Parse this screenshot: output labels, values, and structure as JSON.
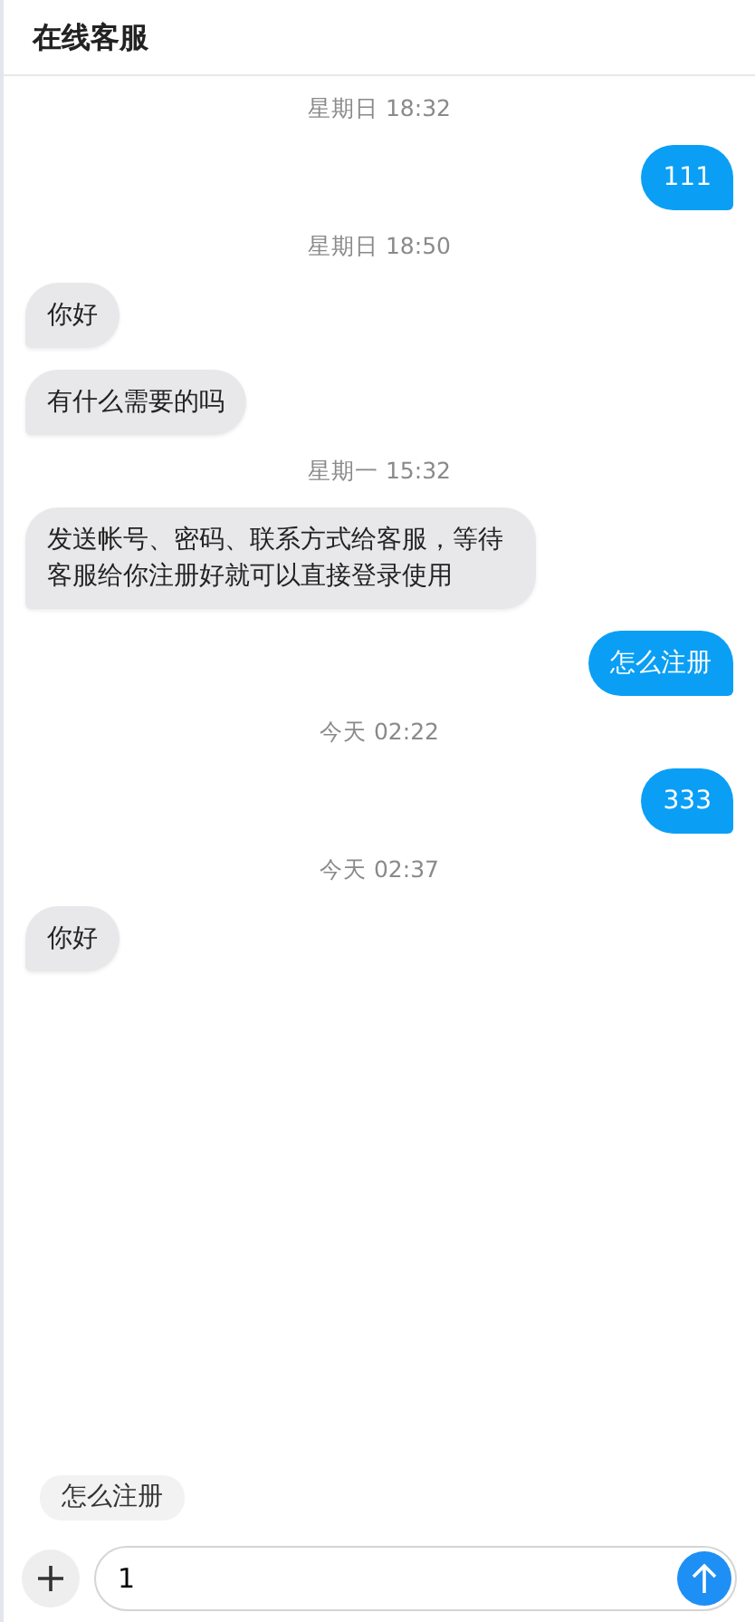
{
  "header": {
    "title": "在线客服"
  },
  "messages": [
    {
      "kind": "time",
      "text": "星期日 18:32"
    },
    {
      "kind": "out",
      "text": "111"
    },
    {
      "kind": "time",
      "text": "星期日 18:50"
    },
    {
      "kind": "in",
      "text": "你好"
    },
    {
      "kind": "in",
      "text": "有什么需要的吗"
    },
    {
      "kind": "time",
      "text": "星期一 15:32"
    },
    {
      "kind": "in",
      "text": "发送帐号、密码、联系方式给客服，等待客服给你注册好就可以直接登录使用"
    },
    {
      "kind": "out",
      "text": "怎么注册"
    },
    {
      "kind": "time",
      "text": "今天 02:22"
    },
    {
      "kind": "out",
      "text": "333"
    },
    {
      "kind": "time",
      "text": "今天 02:37"
    },
    {
      "kind": "in",
      "text": "你好"
    }
  ],
  "quick_replies": [
    "怎么注册"
  ],
  "composer": {
    "value": "1"
  }
}
